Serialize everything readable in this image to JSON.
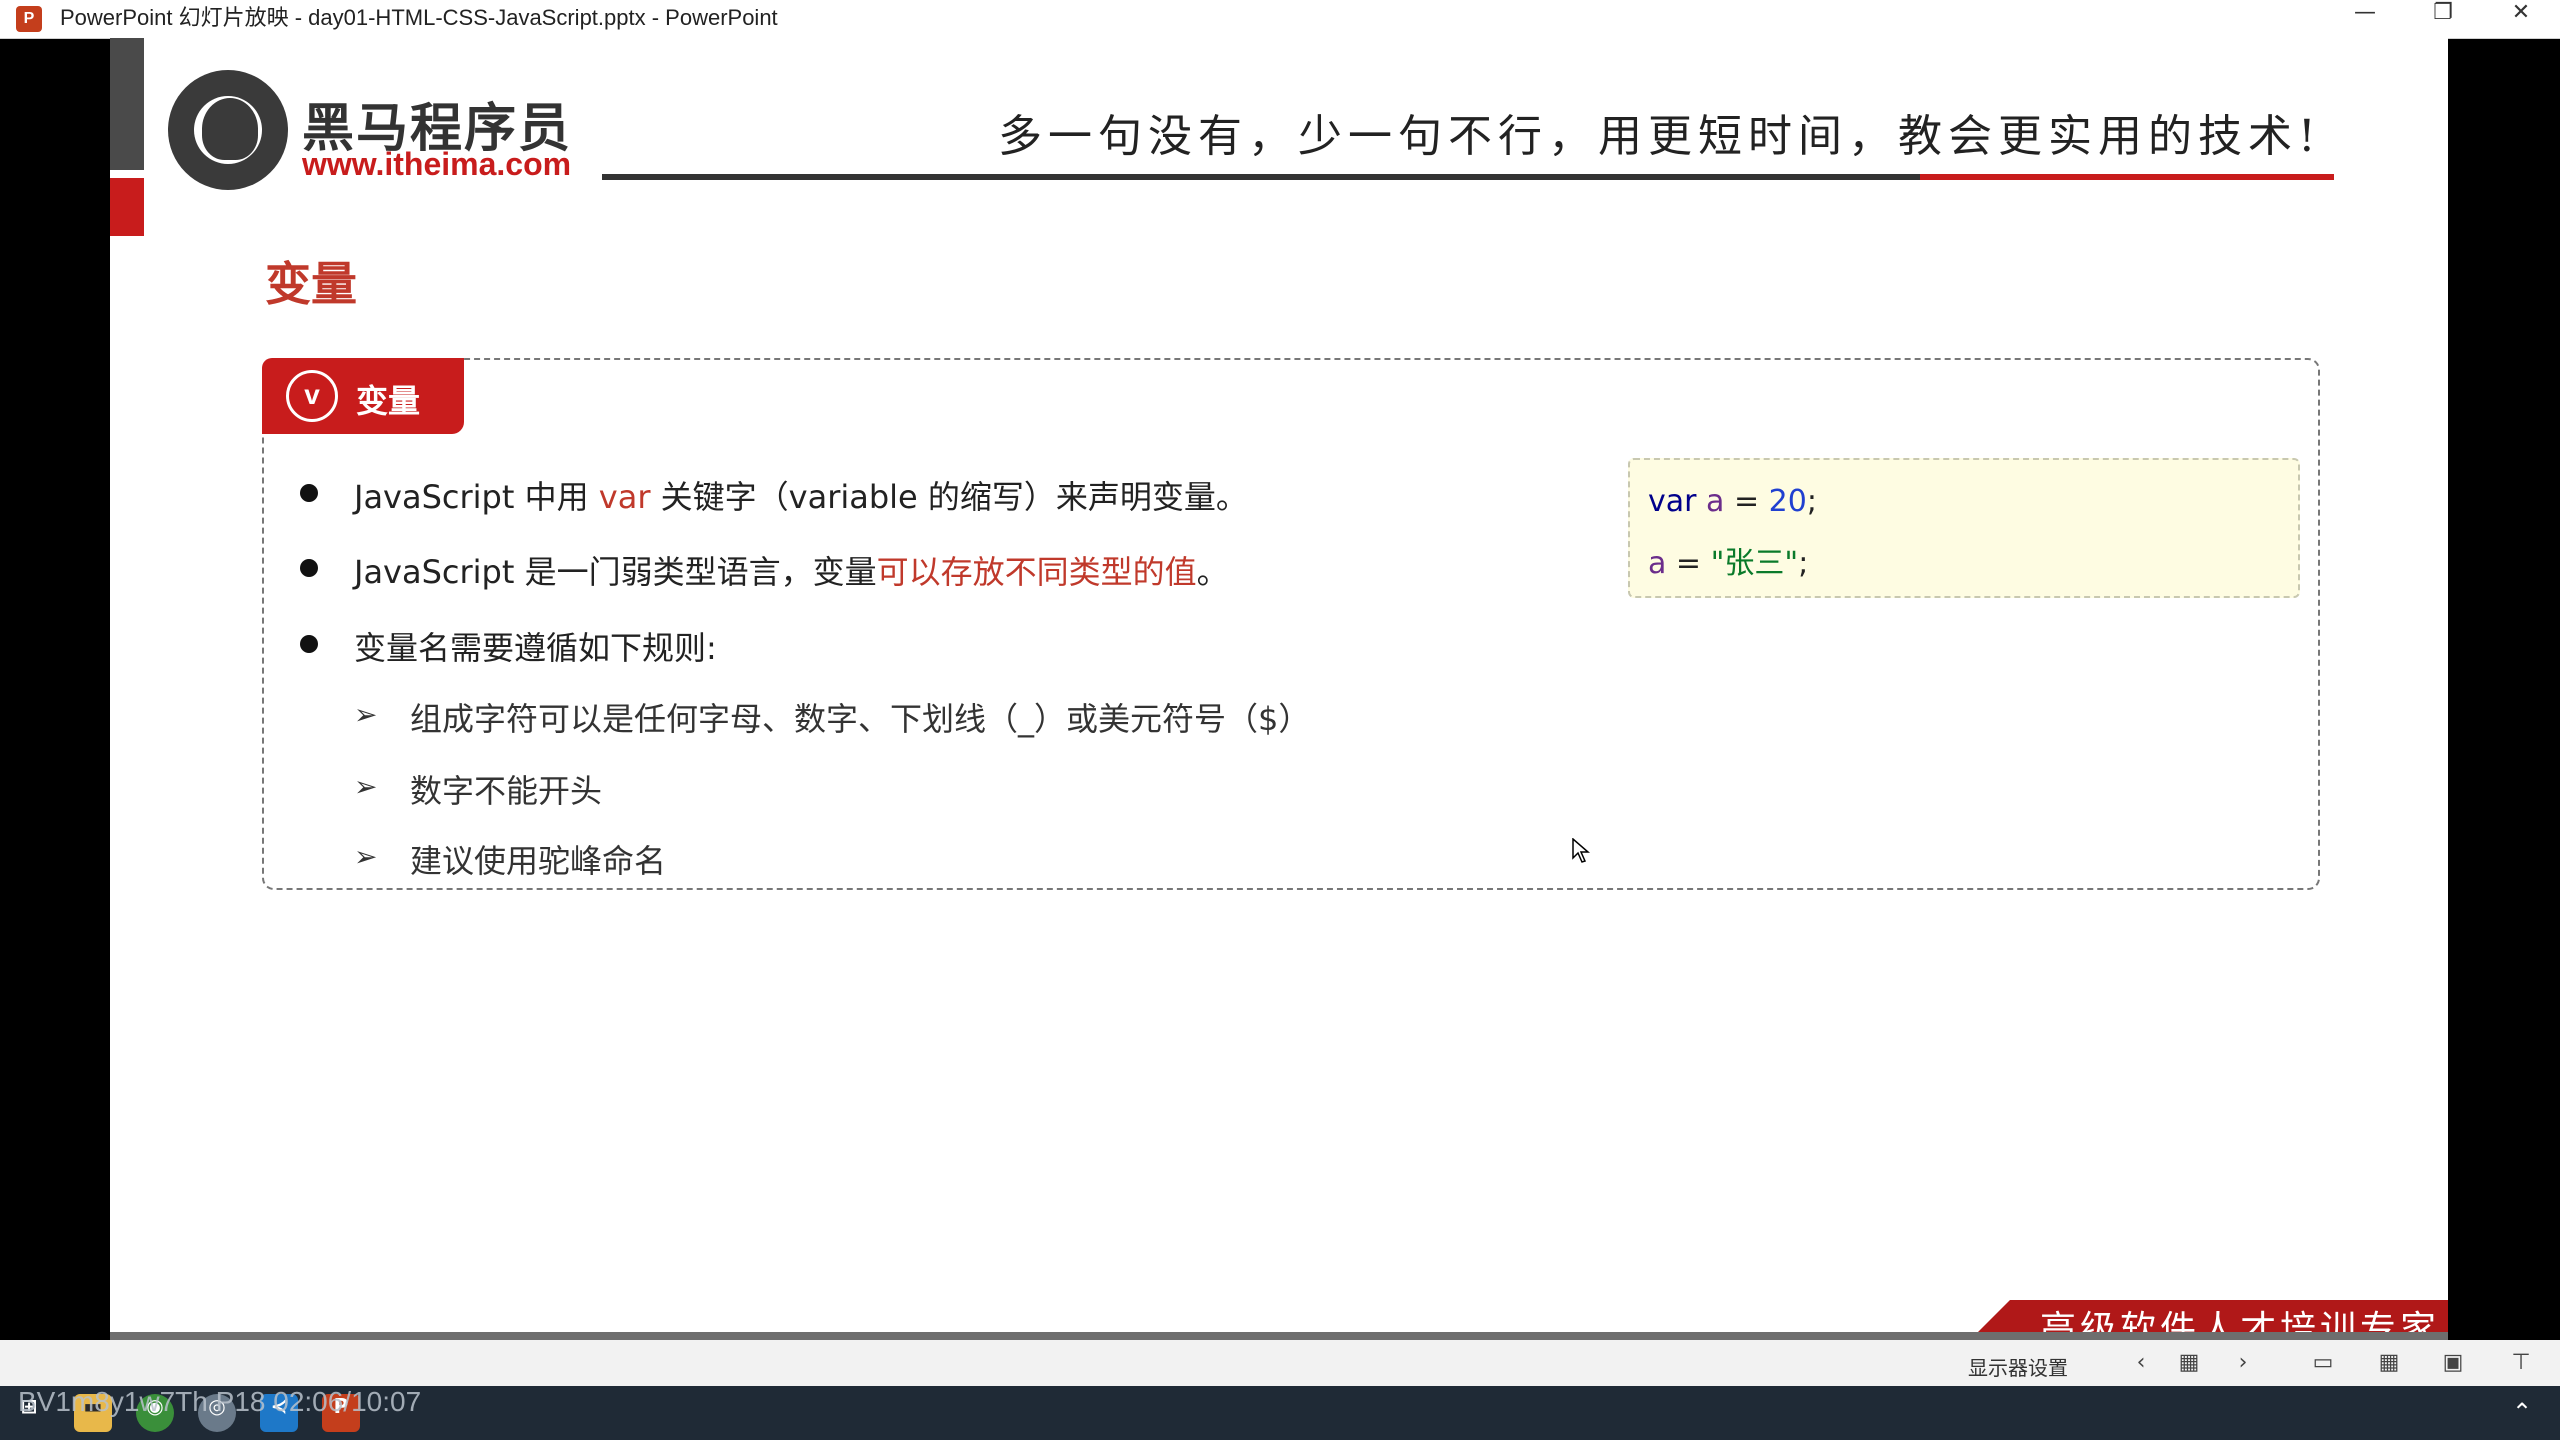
{
  "window": {
    "app_icon": "P",
    "title": "PowerPoint 幻灯片放映  -  day01-HTML-CSS-JavaScript.pptx - PowerPoint",
    "minimize_glyph": "—",
    "restore_glyph": "❐",
    "close_glyph": "✕"
  },
  "slide": {
    "logo_text": "黑马程序员",
    "logo_url": "www.itheima.com",
    "slogan": "多一句没有，少一句不行，用更短时间，教会更实用的技术!",
    "section_title": "变量",
    "box_badge": "v",
    "box_title": "变量",
    "bullet1": {
      "pre": "JavaScript 中用 ",
      "kw": "var",
      "post": " 关键字（variable 的缩写）来声明变量。"
    },
    "bullet2": {
      "pre": "JavaScript 是一门弱类型语言，变量",
      "hl": "可以存放不同类型的值",
      "post": "。"
    },
    "bullet3": "变量名需要遵循如下规则:",
    "arrow_glyph": "➢",
    "rules": [
      "组成字符可以是任何字母、数字、下划线（_）或美元符号（$）",
      "数字不能开头",
      "建议使用驼峰命名"
    ],
    "code": {
      "l1_kw": "var",
      "l1_id": "a",
      "l1_op": " = ",
      "l1_num": "20",
      "l1_end": ";",
      "l2_id": "a",
      "l2_op": " = ",
      "l2_str": "\"张三\"",
      "l2_end": ";"
    },
    "footer": "高级软件人才培训专家"
  },
  "ppt_toolbar": {
    "display_settings": "显示器设置",
    "prev": "‹",
    "next": "›"
  },
  "taskbar": {
    "watermark": "BV1m8y1w7Th P18 02:06/10:07"
  },
  "colors": {
    "accent_red": "#c81c1c",
    "code_bg": "#fefce2"
  }
}
